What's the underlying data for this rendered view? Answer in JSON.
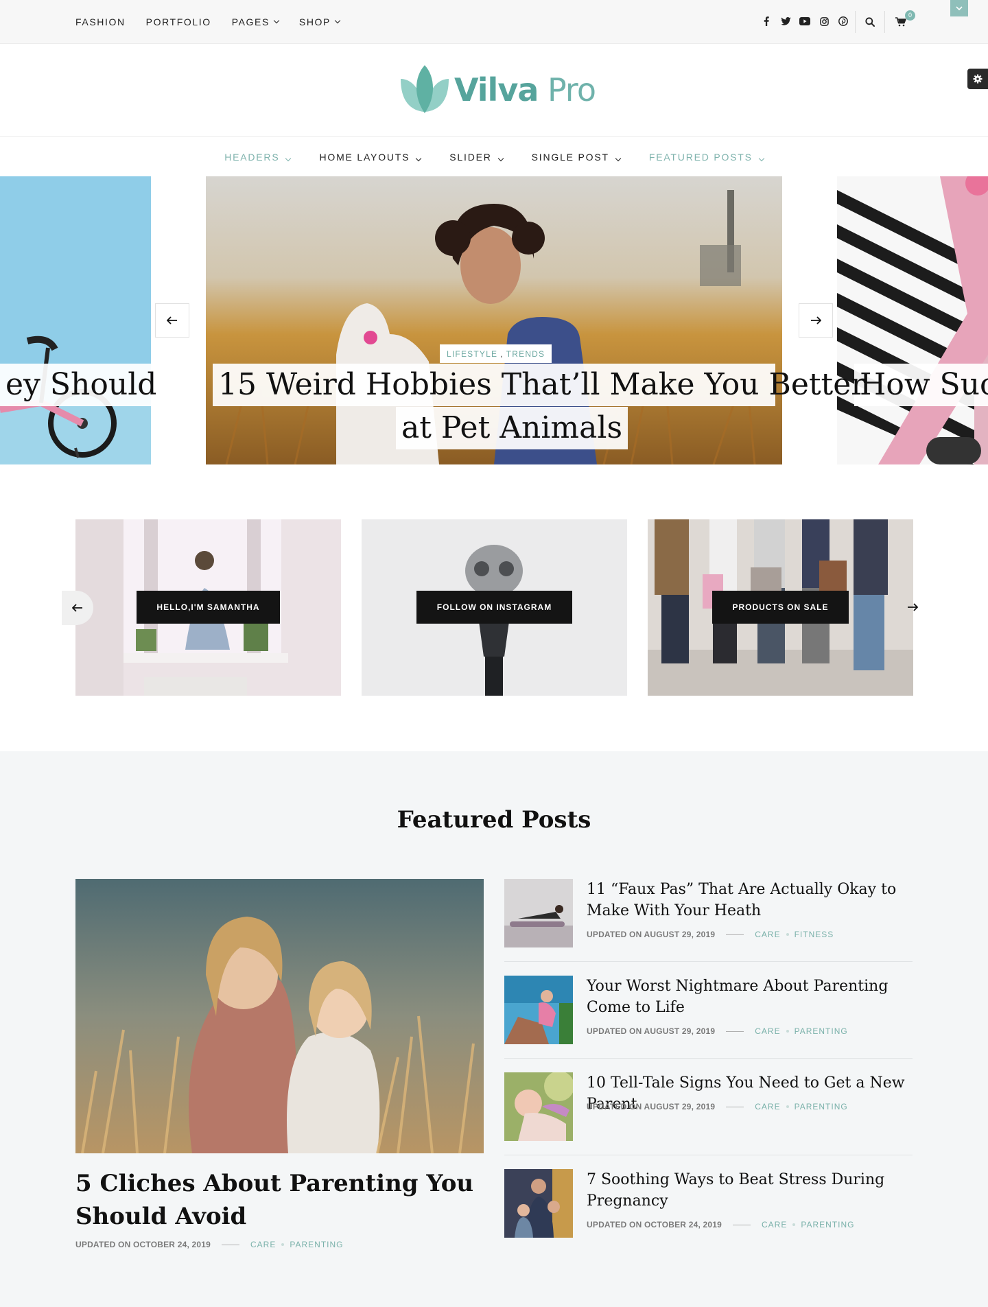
{
  "topnav": {
    "items": [
      {
        "label": "FASHION",
        "has_dropdown": false
      },
      {
        "label": "PORTFOLIO",
        "has_dropdown": false
      },
      {
        "label": "PAGES",
        "has_dropdown": true
      },
      {
        "label": "SHOP",
        "has_dropdown": true
      }
    ],
    "social_icons": [
      "facebook-icon",
      "twitter-icon",
      "youtube-icon",
      "instagram-icon",
      "pinterest-icon"
    ],
    "cart_count": "0"
  },
  "logo": {
    "name_bold": "Vilva",
    "name_light": " Pro"
  },
  "mainnav": {
    "items": [
      {
        "label": "HEADERS",
        "accent": true
      },
      {
        "label": "HOME LAYOUTS",
        "accent": false
      },
      {
        "label": "SLIDER",
        "accent": false
      },
      {
        "label": "SINGLE POST",
        "accent": false
      },
      {
        "label": "FEATURED POSTS",
        "accent": true
      }
    ]
  },
  "slider": {
    "left_title": "ey Should",
    "center_categories": [
      "LIFESTYLE",
      "TRENDS"
    ],
    "center_title_line1": "15 Weird Hobbies That’ll Make You Better",
    "center_title_line2": "at Pet Animals",
    "right_title": "How Succ"
  },
  "promos": [
    {
      "label": "HELLO,I'M SAMANTHA"
    },
    {
      "label": "FOLLOW ON INSTAGRAM"
    },
    {
      "label": "PRODUCTS ON SALE"
    }
  ],
  "featured": {
    "section_title": "Featured Posts",
    "main_post": {
      "title": "5 Cliches About Parenting You Should Avoid",
      "date": "UPDATED ON OCTOBER 24, 2019",
      "categories": [
        "CARE",
        "PARENTING"
      ]
    },
    "side_posts": [
      {
        "title": "11 “Faux Pas” That Are Actually Okay to Make With Your Heath",
        "date": "UPDATED ON AUGUST 29, 2019",
        "categories": [
          "CARE",
          "FITNESS"
        ]
      },
      {
        "title": "Your Worst Nightmare About Parenting Come to Life",
        "date": "UPDATED ON AUGUST 29, 2019",
        "categories": [
          "CARE",
          "PARENTING"
        ]
      },
      {
        "title": "10 Tell-Tale Signs You Need to Get a New Parent",
        "date": "UPDATED ON AUGUST 29, 2019",
        "categories": [
          "CARE",
          "PARENTING"
        ]
      },
      {
        "title": "7 Soothing Ways to Beat Stress During Pregnancy",
        "date": "UPDATED ON OCTOBER 24, 2019",
        "categories": [
          "CARE",
          "PARENTING"
        ]
      }
    ]
  },
  "colors": {
    "accent": "#7fb3ad",
    "logo": "#56a49c",
    "dark_button": "#141414",
    "section_bg": "#f4f6f7"
  }
}
